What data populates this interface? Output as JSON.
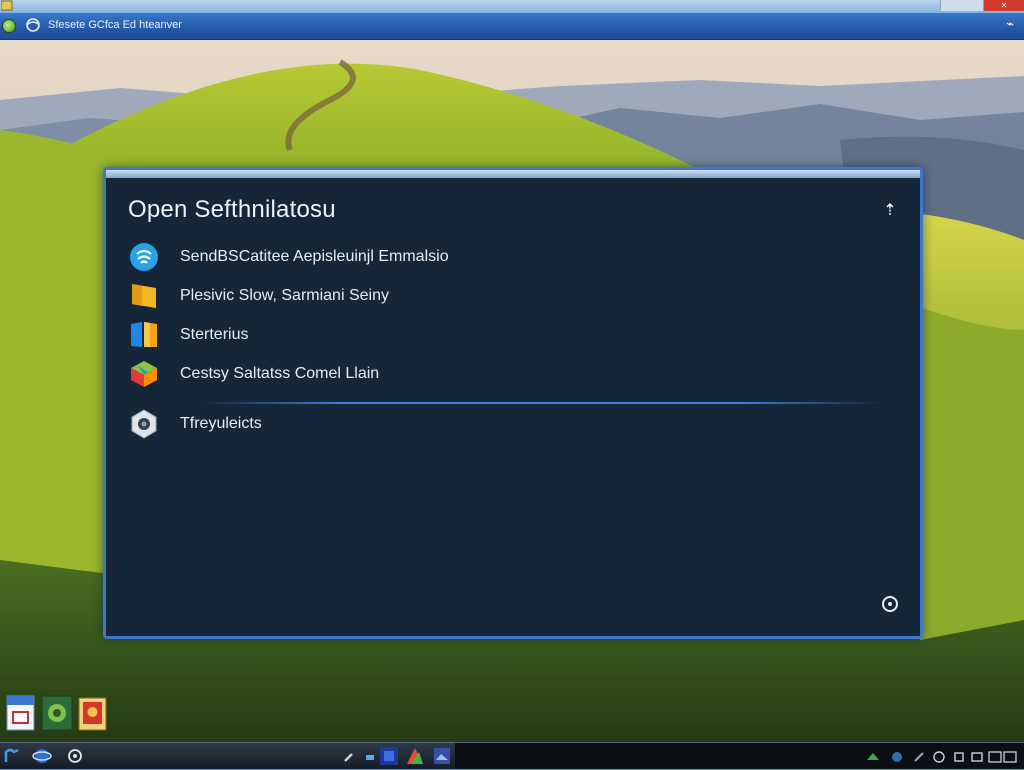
{
  "window": {
    "title": "Sfesete GCfca Ed hteanver"
  },
  "dialog": {
    "title": "Open Sefthnilatosu",
    "items": [
      {
        "label": "SendBSCatitee Aepisleuinjl Emmalsio",
        "icon": "chat-bubble-icon"
      },
      {
        "label": "Plesivic Slow, Sarmiani Seiny",
        "icon": "folder-icon"
      },
      {
        "label": "Sterterius",
        "icon": "windows-flag-icon"
      },
      {
        "label": "Cestsy Saltatss Comel Llain",
        "icon": "color-cube-icon"
      },
      {
        "label": "Tfreyuleicts",
        "icon": "camera-icon"
      }
    ],
    "pin_glyph": "⇡"
  },
  "desktop_icons": [
    "document-icon",
    "green-app-icon",
    "red-app-icon"
  ],
  "taskbar": {
    "buttons": [
      "start-icon",
      "browser-icon",
      "search-icon",
      "pen-icon",
      "chat-icon",
      "blue-app-icon",
      "multicolor-app-icon",
      "image-app-icon"
    ],
    "tray": [
      "network-icon",
      "volume-icon",
      "clock-icon",
      "settings-icon",
      "window-icon"
    ]
  },
  "colors": {
    "dialog_bg": "#152638",
    "dialog_border": "#3c78cf",
    "accent": "#3a7fd8"
  }
}
